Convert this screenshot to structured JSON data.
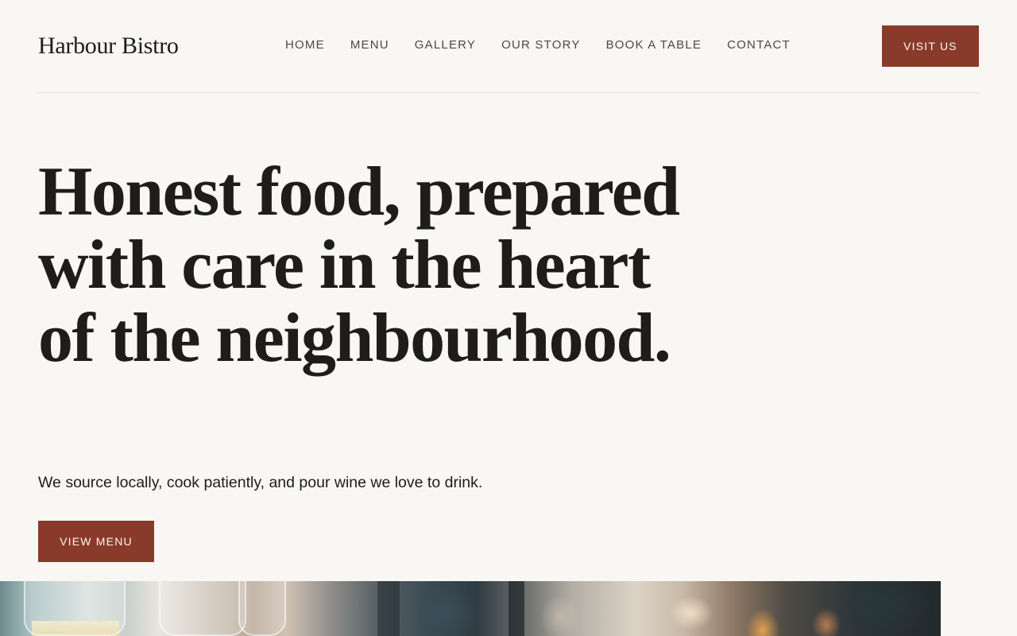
{
  "brand": {
    "name": "Harbour Bistro",
    "accent_color": "#8a3a2a",
    "background_color": "#f9f7f3"
  },
  "nav": {
    "items": [
      {
        "label": "HOME"
      },
      {
        "label": "MENU"
      },
      {
        "label": "GALLERY"
      },
      {
        "label": "OUR STORY"
      },
      {
        "label": "BOOK A TABLE"
      },
      {
        "label": "CONTACT"
      }
    ],
    "cta_label": "VISIT US"
  },
  "hero": {
    "headline": "Honest food, prepared with care in the heart of the neighbourhood.",
    "subheadline": "We source locally, cook patiently, and pour wine we love to drink.",
    "cta_label": "VIEW MENU"
  },
  "photo": {
    "subject": "restaurant-bar-image"
  }
}
